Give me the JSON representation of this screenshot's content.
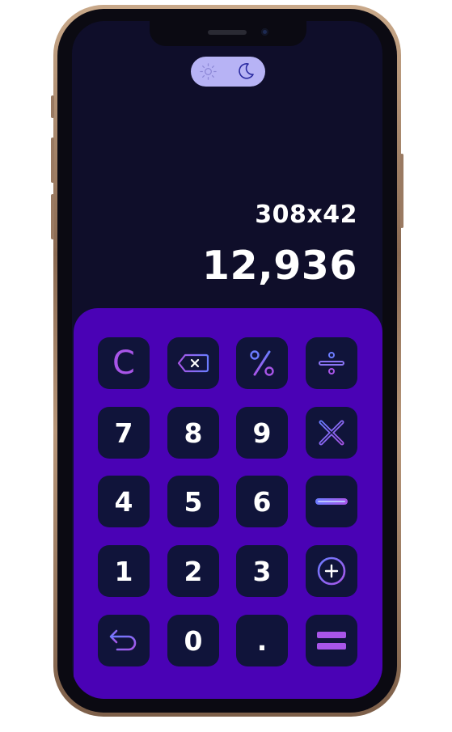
{
  "theme_toggle": {
    "sun_icon": "sun-icon",
    "moon_icon": "moon-icon",
    "active": "dark"
  },
  "display": {
    "expression": "308x42",
    "result": "12,936"
  },
  "keys": {
    "clear": "C",
    "seven": "7",
    "eight": "8",
    "nine": "9",
    "four": "4",
    "five": "5",
    "six": "6",
    "one": "1",
    "two": "2",
    "three": "3",
    "zero": "0",
    "decimal": "."
  },
  "icons": {
    "backspace": "backspace-icon",
    "percent": "percent-icon",
    "divide": "divide-icon",
    "multiply": "multiply-icon",
    "minus": "minus-icon",
    "plus": "plus-icon",
    "undo": "undo-icon",
    "equals": "equals-icon"
  },
  "colors": {
    "screen_bg": "#0f0e2a",
    "keypad_bg": "#4a02b5",
    "key_bg": "#10143a",
    "accent_purple": "#a855e8",
    "accent_blue": "#6b7cff",
    "toggle_bg": "#b7b3f5"
  }
}
